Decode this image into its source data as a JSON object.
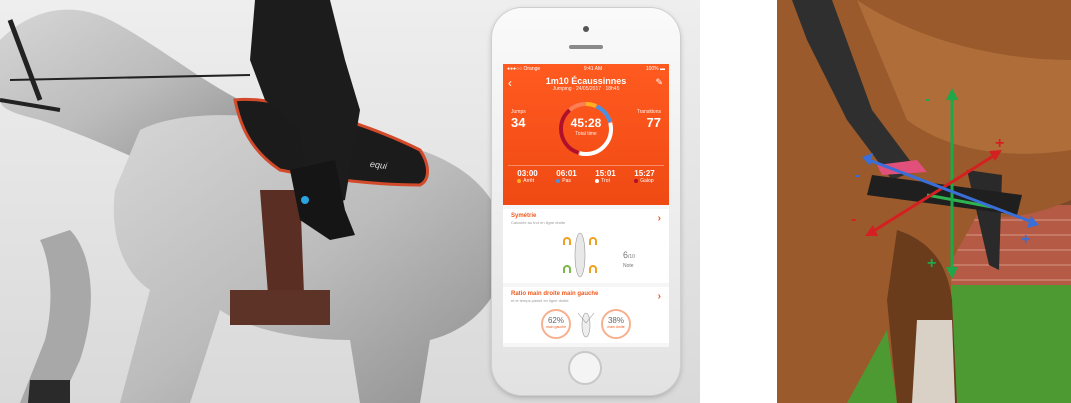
{
  "phone": {
    "status_bar": {
      "carrier": "●●●○○ Orange",
      "time": "9:41 AM",
      "battery": "100% ▬"
    },
    "session": {
      "title": "1m10 Écaussinnes",
      "subtitle": "Jumping · 24/05/2017 · 18h45",
      "jumps_label": "Jumps",
      "jumps_value": "34",
      "total_time": "45:28",
      "total_time_label": "Total time",
      "transitions_label": "Transitions",
      "transitions_value": "77"
    },
    "gaits": [
      {
        "time": "03:00",
        "name": "Arrêt"
      },
      {
        "time": "06:01",
        "name": "Pas"
      },
      {
        "time": "15:01",
        "name": "Trot"
      },
      {
        "time": "15:27",
        "name": "Galop"
      }
    ],
    "gait_colors": [
      "#ffb020",
      "#4a90e2",
      "#ffffff",
      "#b0102a"
    ],
    "symmetry": {
      "title": "Symétrie",
      "subtitle": "Calculée au trot en ligne droite",
      "score": "6",
      "score_max": "/10",
      "score_label": "Note"
    },
    "ratio": {
      "title": "Ratio main droite main gauche",
      "subtitle": "et le temps passé en ligne droite",
      "left_pct": "62%",
      "left_label": "main gauche",
      "right_pct": "38%",
      "right_label": "main droite"
    },
    "accent_color": "#f05a1e"
  },
  "saddle_pad_brand": "equi",
  "axes": {
    "green_top": "-",
    "green_bottom": "+",
    "red_top": "+",
    "red_bottom": "-",
    "blue_left": "-",
    "blue_right": "+"
  }
}
